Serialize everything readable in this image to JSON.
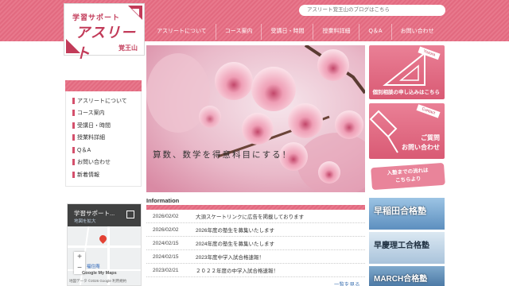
{
  "search": {
    "placeholder": "アスリート覚王山のブログはこちら"
  },
  "logo": {
    "sub": "学習サポート",
    "main": "アスリート",
    "location": "覚王山"
  },
  "global_nav": [
    "アスリートについて",
    "コース案内",
    "受講日・時間",
    "授業料詳細",
    "Q＆A",
    "お問い合わせ"
  ],
  "side_nav": [
    "アスリートについて",
    "コース案内",
    "受講日・時間",
    "授業料詳細",
    "Q＆A",
    "お問い合わせ",
    "新着情報"
  ],
  "map": {
    "title": "学習サポート...",
    "subtitle": "地図を拡大",
    "footer": "地図データ ©2026 Google  利用規約",
    "labels": {
      "place1": "福住庵",
      "google": "Google My Maps"
    }
  },
  "hero": {
    "caption": "算数、数学を得意科目にする！"
  },
  "information": {
    "title": "Information",
    "items": [
      {
        "date": "2026/02/02",
        "text": "大須スケートリンクに広告を掲載しております"
      },
      {
        "date": "2026/02/02",
        "text": "2026年度の塾生を募集いたします"
      },
      {
        "date": "2024/02/15",
        "text": "2024年度の塾生を募集いたします"
      },
      {
        "date": "2024/02/15",
        "text": "2023年度中学入試合格速報！"
      },
      {
        "date": "2023/02/21",
        "text": "２０２２年度の中学入試合格速報！"
      }
    ],
    "more": "一覧を見る"
  },
  "banners": {
    "consult": {
      "tag": "Yozora",
      "label_line1": "個別相談の申し込みはこちら"
    },
    "contact": {
      "tag": "Contact",
      "label_line1": "ご質問",
      "label_line2": "お問い合わせ"
    },
    "flow": {
      "line1": "入塾までの流れは",
      "line2": "こちらより"
    },
    "ad1": {
      "text": "早稲田合格塾"
    },
    "ad2": {
      "text": "早慶理工合格塾"
    },
    "ad3": {
      "text": "MARCH合格塾"
    }
  },
  "colors": {
    "brand": "#c23b59",
    "band": "#e26a80",
    "link": "#3a6fb0"
  }
}
